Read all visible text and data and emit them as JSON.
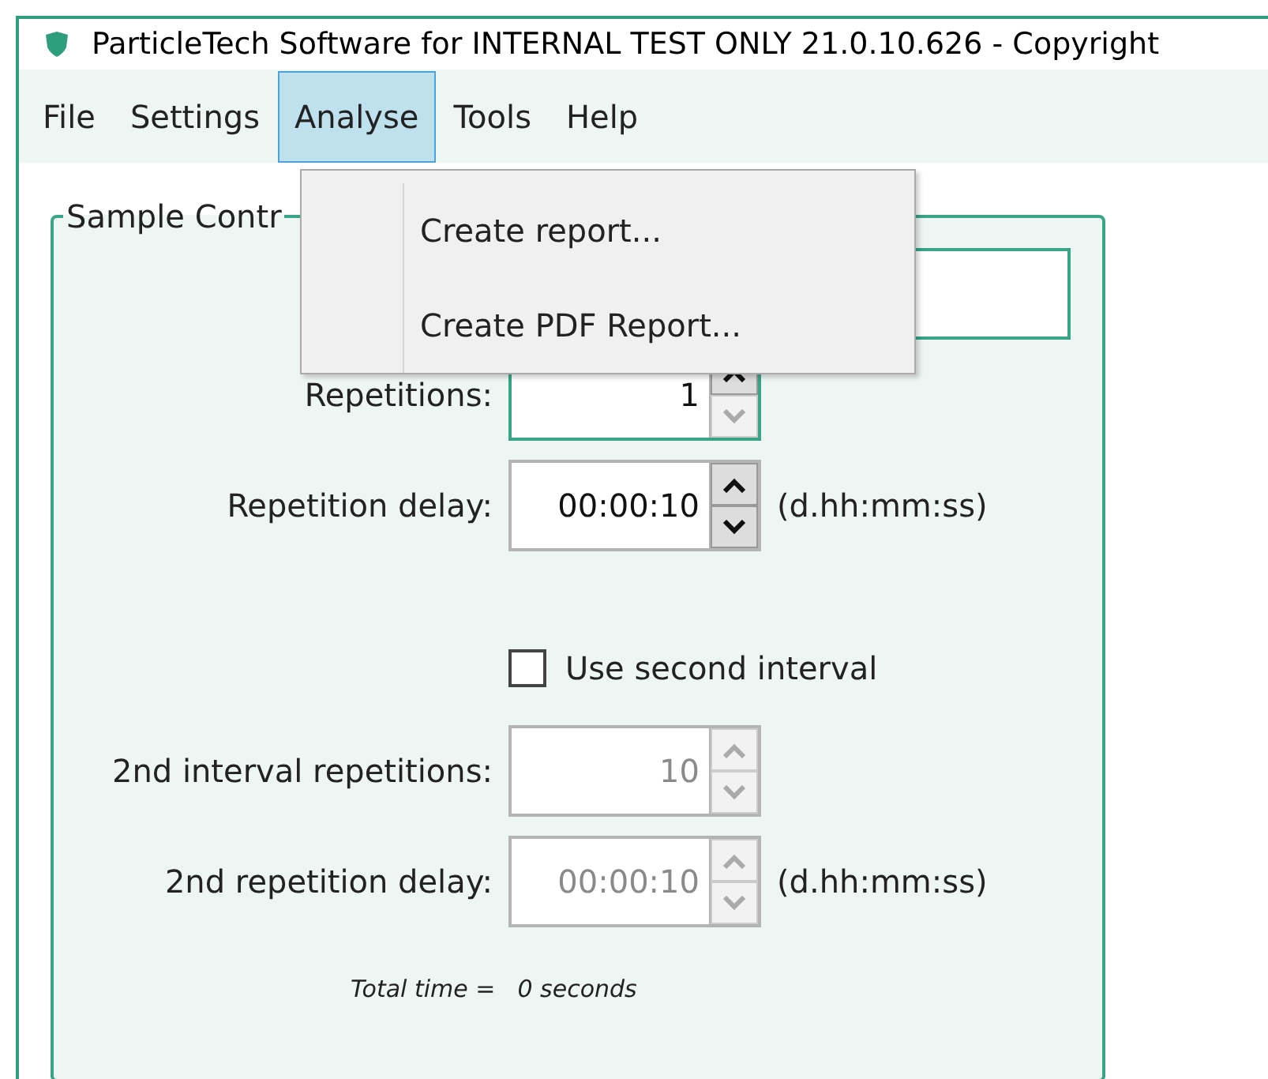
{
  "window": {
    "title": "ParticleTech Software for INTERNAL TEST ONLY 21.0.10.626 - Copyright"
  },
  "menu_bar": [
    {
      "label": "File",
      "selected": false
    },
    {
      "label": "Settings",
      "selected": false
    },
    {
      "label": "Analyse",
      "selected": true
    },
    {
      "label": "Tools",
      "selected": false
    },
    {
      "label": "Help",
      "selected": false
    }
  ],
  "open_menu": {
    "items": [
      "Create report...",
      "Create PDF Report..."
    ]
  },
  "group": {
    "legend": "Sample Contr",
    "fields": [
      {
        "label": "Repetitions:",
        "value": "1",
        "disabled": false,
        "focused": true,
        "up_enabled": true,
        "down_enabled": false
      },
      {
        "label": "Repetition delay:",
        "value": "00:00:10",
        "unit": "(d.hh:mm:ss)",
        "disabled": false,
        "focused": false,
        "up_enabled": true,
        "down_enabled": true
      }
    ],
    "second_interval": {
      "label": "Use second interval",
      "checked": false
    },
    "second_fields": [
      {
        "label": "2nd interval repetitions:",
        "value": "10",
        "disabled": true,
        "focused": false,
        "up_enabled": false,
        "down_enabled": false
      },
      {
        "label": "2nd repetition delay:",
        "value": "00:00:10",
        "unit": "(d.hh:mm:ss)",
        "disabled": true,
        "focused": false,
        "up_enabled": false,
        "down_enabled": false
      }
    ],
    "total": {
      "label": "Total time =",
      "value": "0 seconds"
    }
  }
}
